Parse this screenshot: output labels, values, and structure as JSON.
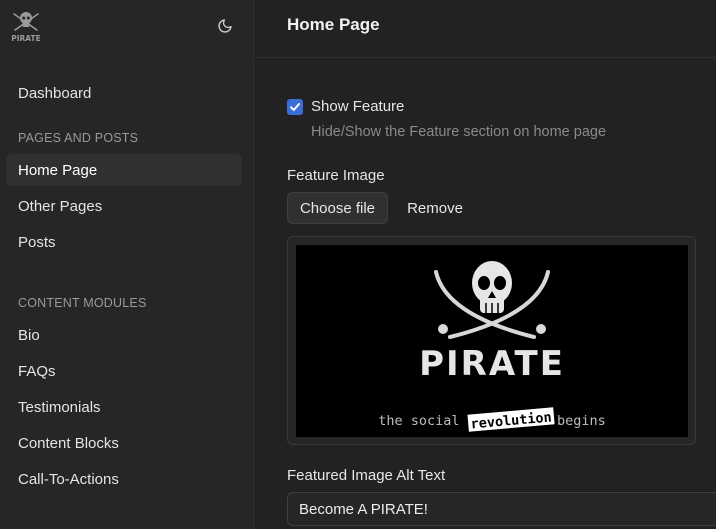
{
  "sidebar": {
    "logo": {
      "icon": "pirate-skull-logo",
      "text": "PIRATE"
    },
    "theme_toggle_icon": "moon-icon",
    "dashboard_label": "Dashboard",
    "sections": [
      {
        "title": "PAGES AND POSTS",
        "items": [
          "Home Page",
          "Other Pages",
          "Posts"
        ]
      },
      {
        "title": "CONTENT MODULES",
        "items": [
          "Bio",
          "FAQs",
          "Testimonials",
          "Content Blocks",
          "Call-To-Actions"
        ]
      }
    ],
    "active_item": "Home Page"
  },
  "main": {
    "title": "Home Page",
    "show_feature": {
      "checked": true,
      "label": "Show Feature",
      "help": "Hide/Show the Feature section on home page"
    },
    "feature_image": {
      "label": "Feature Image",
      "choose_label": "Choose file",
      "remove_label": "Remove",
      "preview": {
        "brand": "PIRATE",
        "tagline": "the social revolution begins",
        "overlay_word": "revolution"
      }
    },
    "alt_text": {
      "label": "Featured Image Alt Text",
      "value": "Become A PIRATE!"
    }
  },
  "colors": {
    "background": "#222222",
    "sidebar": "#262626",
    "accent": "#3b6fd8",
    "active_item": "#303030",
    "muted_text": "#8a8a8a"
  }
}
